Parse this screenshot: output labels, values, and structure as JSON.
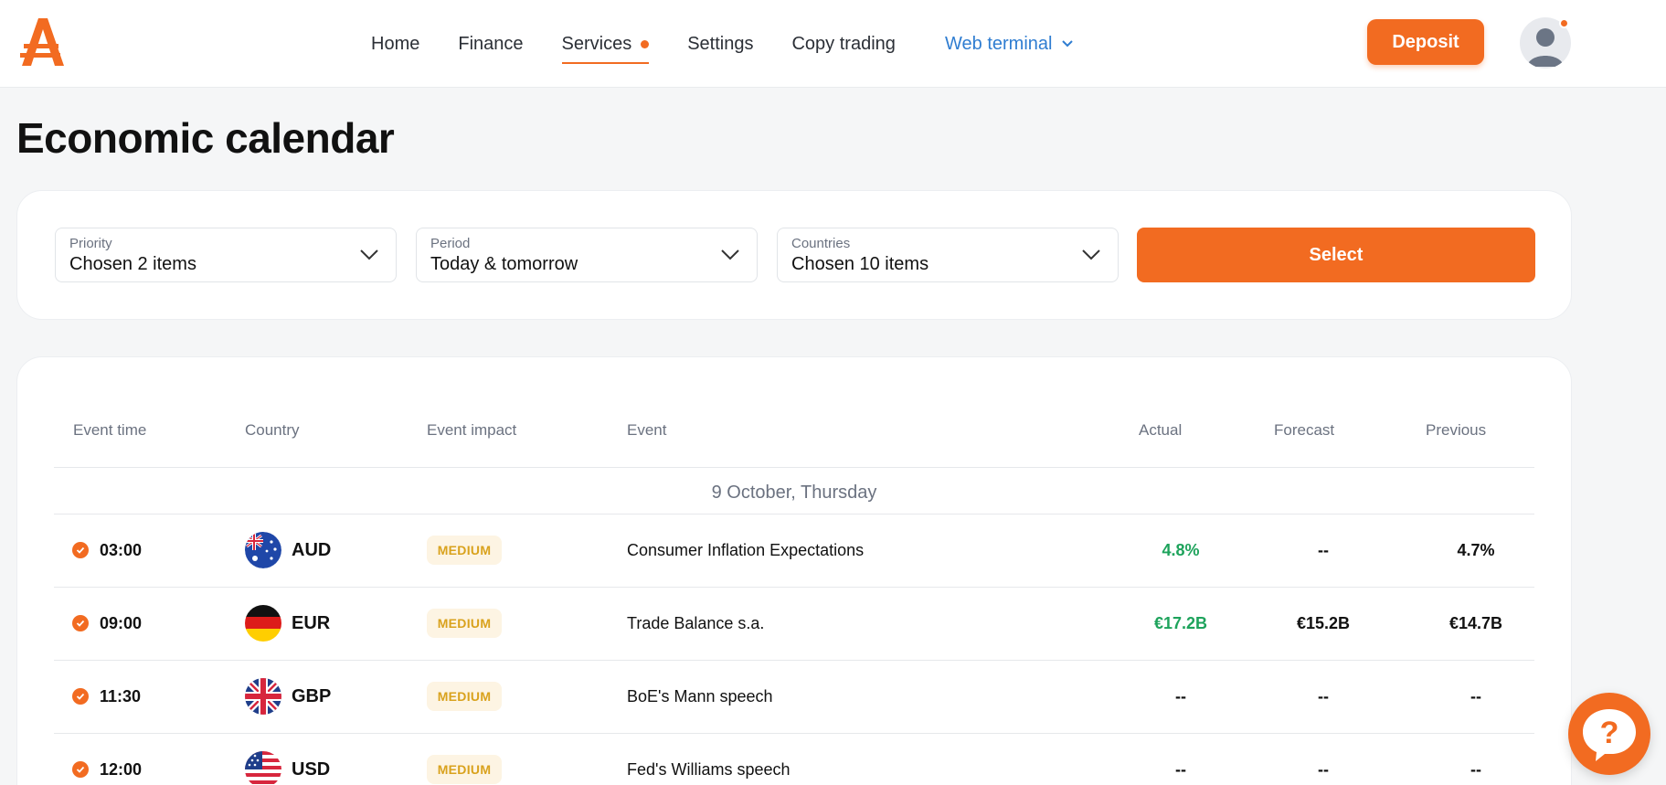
{
  "nav": {
    "items": [
      {
        "label": "Home"
      },
      {
        "label": "Finance"
      },
      {
        "label": "Services"
      },
      {
        "label": "Settings"
      },
      {
        "label": "Copy trading"
      }
    ],
    "web_terminal": "Web terminal",
    "deposit": "Deposit"
  },
  "page": {
    "title": "Economic calendar"
  },
  "filters": {
    "priority": {
      "label": "Priority",
      "value": "Chosen 2 items"
    },
    "period": {
      "label": "Period",
      "value": "Today & tomorrow"
    },
    "countries": {
      "label": "Countries",
      "value": "Chosen 10 items"
    },
    "select_button": "Select"
  },
  "table": {
    "headers": {
      "event_time": "Event time",
      "country": "Country",
      "event_impact": "Event impact",
      "event": "Event",
      "actual": "Actual",
      "forecast": "Forecast",
      "previous": "Previous"
    },
    "date_group": "9 October, Thursday",
    "rows": [
      {
        "time": "03:00",
        "currency": "AUD",
        "impact": "MEDIUM",
        "event": "Consumer Inflation Expectations",
        "actual": "4.8%",
        "forecast": "--",
        "previous": "4.7%"
      },
      {
        "time": "09:00",
        "currency": "EUR",
        "impact": "MEDIUM",
        "event": "Trade Balance s.a.",
        "actual": "€17.2B",
        "forecast": "€15.2B",
        "previous": "€14.7B"
      },
      {
        "time": "11:30",
        "currency": "GBP",
        "impact": "MEDIUM",
        "event": "BoE's Mann speech",
        "actual": "--",
        "forecast": "--",
        "previous": "--"
      },
      {
        "time": "12:00",
        "currency": "USD",
        "impact": "MEDIUM",
        "event": "Fed's Williams speech",
        "actual": "--",
        "forecast": "--",
        "previous": "--"
      }
    ]
  },
  "colors": {
    "accent": "#f26b21",
    "link": "#2f7dd1",
    "positive": "#1ea35c",
    "badge_bg": "#fdf4e3",
    "badge_text": "#d9a21d"
  },
  "icons": [
    "logo-icon",
    "services-dot-icon",
    "chevron-down-icon",
    "user-avatar-icon",
    "check-icon",
    "flag-au-icon",
    "flag-de-icon",
    "flag-gb-icon",
    "flag-us-icon",
    "help-icon"
  ]
}
